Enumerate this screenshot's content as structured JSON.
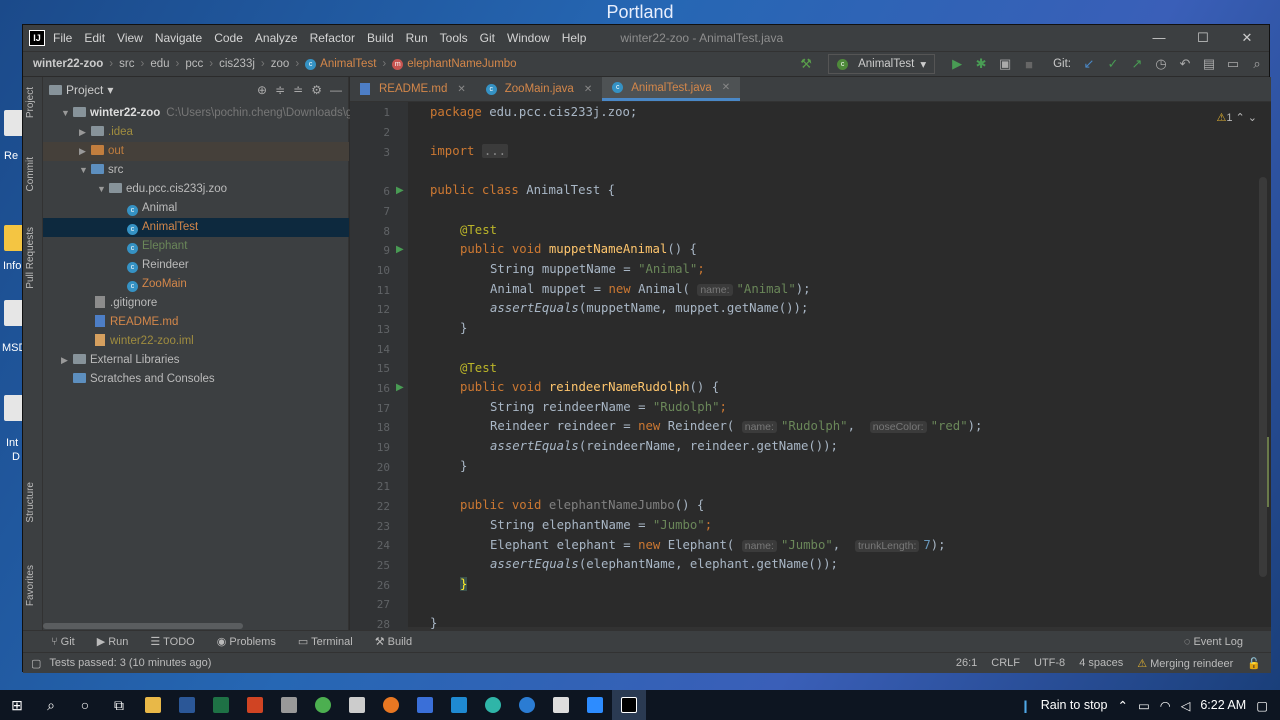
{
  "desktop": {
    "title": "Portland",
    "fragments": [
      "Re",
      "Info",
      "MSD",
      "Int",
      "D"
    ]
  },
  "window": {
    "menu": [
      "File",
      "Edit",
      "View",
      "Navigate",
      "Code",
      "Analyze",
      "Refactor",
      "Build",
      "Run",
      "Tools",
      "Git",
      "Window",
      "Help"
    ],
    "title": "winter22-zoo - AnimalTest.java",
    "controls": [
      "—",
      "☐",
      "✕"
    ]
  },
  "breadcrumb": {
    "items": [
      "winter22-zoo",
      "src",
      "edu",
      "pcc",
      "cis233j",
      "zoo",
      "AnimalTest",
      "elephantNameJumbo"
    ],
    "run_config": "AnimalTest",
    "git_label": "Git:"
  },
  "side_tabs": {
    "left": [
      "Project",
      "Commit",
      "Pull Requests",
      "Structure",
      "Favorites"
    ]
  },
  "project": {
    "header": "Project",
    "root": "winter22-zoo",
    "root_path": "C:\\Users\\pochin.cheng\\Downloads\\gi",
    "items": [
      ".idea",
      "out",
      "src",
      "edu.pcc.cis233j.zoo",
      "Animal",
      "AnimalTest",
      "Elephant",
      "Reindeer",
      "ZooMain",
      ".gitignore",
      "README.md",
      "winter22-zoo.iml",
      "External Libraries",
      "Scratches and Consoles"
    ]
  },
  "editor": {
    "tabs": [
      "README.md",
      "ZooMain.java",
      "AnimalTest.java"
    ],
    "warnings": "1",
    "line_numbers": [
      "1",
      "2",
      "3",
      "6",
      "7",
      "8",
      "9",
      "10",
      "11",
      "12",
      "13",
      "14",
      "15",
      "16",
      "17",
      "18",
      "19",
      "20",
      "21",
      "22",
      "23",
      "24",
      "25",
      "26",
      "27",
      "28"
    ],
    "code": {
      "l1_kw": "package",
      "l1_rest": " edu.pcc.cis233j.zoo;",
      "l3_kw": "import",
      "l3_fold": "...",
      "l6_kw": "public class",
      "l6_rest": " AnimalTest {",
      "ann_test": "@Test",
      "m1_kw": "public void ",
      "m1_name": "muppetNameAnimal",
      "m1_rest": "() {",
      "s_kw": "String",
      "m1_var": " muppetName = ",
      "m1_str": "\"Animal\"",
      "semi": ";",
      "m1_l2a": "Animal muppet = ",
      "new_kw": "new",
      "m1_l2b": " Animal(",
      "hint_name": "name:",
      "m1_l2c": ");",
      "assert": "assertEquals",
      "m1_l3": "(muppetName, muppet.getName());",
      "close": "}",
      "m2_name": "reindeerNameRudolph",
      "m2_var": " reindeerName = ",
      "m2_str": "\"Rudolph\"",
      "m2_l2a": "Reindeer reindeer = ",
      "m2_l2b": " Reindeer(",
      "m2_str2": "\"Rudolph\"",
      "hint_nose": "noseColor:",
      "m2_str3": "\"red\"",
      "m2_l3": "(reindeerName, reindeer.getName());",
      "m3_name": "elephantNameJumbo",
      "m3_var": " elephantName = ",
      "m3_str": "\"Jumbo\"",
      "m3_l2a": "Elephant elephant = ",
      "m3_l2b": " Elephant(",
      "m3_str2": "\"Jumbo\"",
      "hint_trunk": "trunkLength:",
      "m3_num": "7",
      "m3_l3": "(elephantName, elephant.getName());"
    }
  },
  "bottom_tools": [
    "Git",
    "Run",
    "TODO",
    "Problems",
    "Terminal",
    "Build"
  ],
  "event_log": "Event Log",
  "status": {
    "message": "Tests passed: 3 (10 minutes ago)",
    "position": "26:1",
    "line_sep": "CRLF",
    "encoding": "UTF-8",
    "indent": "4 spaces",
    "branch": "Merging reindeer"
  },
  "taskbar": {
    "weather": "Rain to stop",
    "time": "6:22 AM"
  },
  "colors": {
    "accent": "#4a88c7",
    "keyword": "#cc7832",
    "string": "#6a8759",
    "annotation": "#bbb529",
    "method": "#ffc66d"
  }
}
